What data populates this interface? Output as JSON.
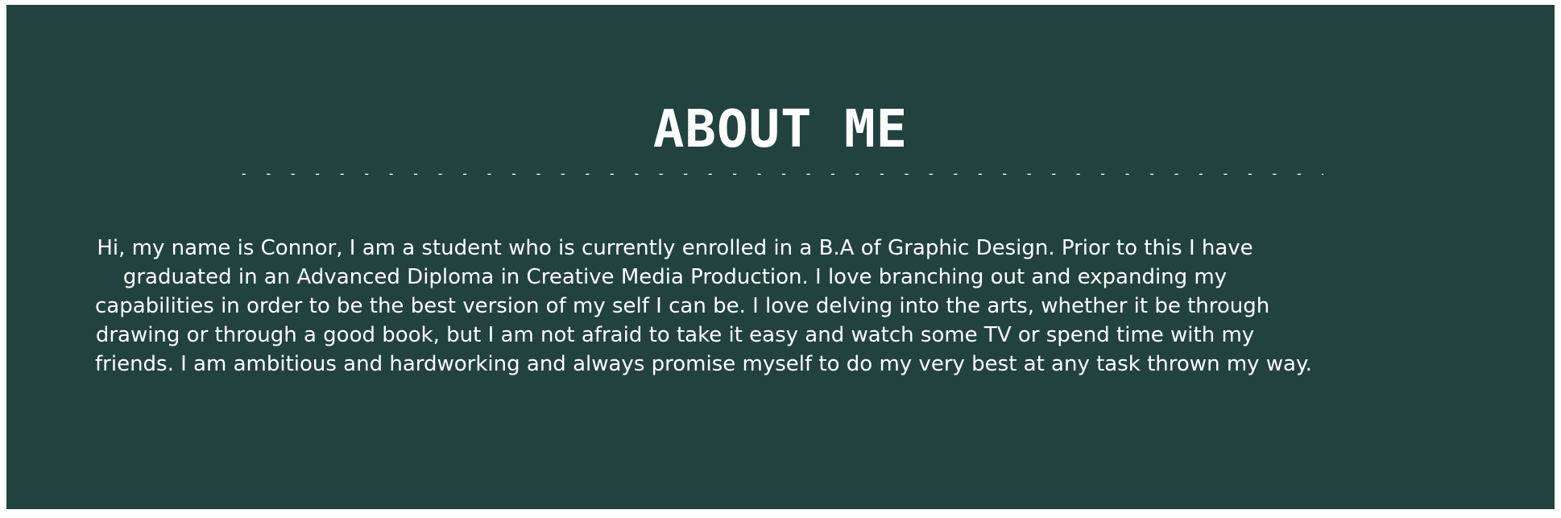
{
  "section": {
    "title": "ABOUT ME",
    "divider": "- - - - - - - - - - - - - - - - - - - - - - - - - - - - - - - - - - - - - - - - - - - - - - - - - - - - - - - - - - - - - - - - - - - - - - - - - - - - - - - - - - - - - - - - - - - -",
    "bio_lines": [
      "Hi, my name is Connor, I am a student who is currently enrolled in a B.A of Graphic Design. Prior to this I have",
      "graduated in an Advanced Diploma in Creative Media Production. I love branching out and expanding my",
      "capabilities in order to be the best version of my self I can be. I love delving into the arts, whether it be through",
      "drawing or through a good book, but I am not afraid to take it easy  and watch some TV or spend time with my",
      "friends. I am ambitious and hardworking and always promise myself to do my very best at any task thrown my way."
    ]
  },
  "colors": {
    "background": "#22423f",
    "text": "#ffffff"
  }
}
